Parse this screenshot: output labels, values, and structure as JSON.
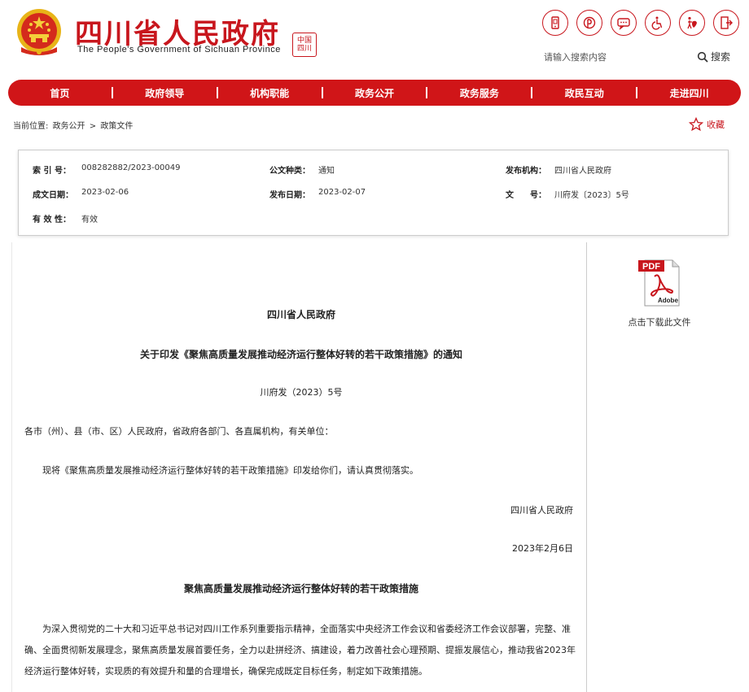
{
  "header": {
    "title": "四川省人民政府",
    "subtitle": "The People's Government of Sichuan Province",
    "seal_text": "中国四川",
    "search": {
      "placeholder": "请输入搜索内容",
      "button_label": "搜索"
    }
  },
  "nav": {
    "items": [
      "首页",
      "政府领导",
      "机构职能",
      "政务公开",
      "政务服务",
      "政民互动",
      "走进四川"
    ]
  },
  "breadcrumb": {
    "prefix": "当前位置:",
    "items": [
      "政务公开",
      ">",
      "政策文件"
    ]
  },
  "favorite": {
    "label": "收藏"
  },
  "info": {
    "index_label": "索 引 号：",
    "index_value": "008282882/2023-00049",
    "category_label": "公文种类：",
    "category_value": "通知",
    "publisher_label": "发布机构：",
    "publisher_value": "四川省人民政府",
    "created_label": "成文日期：",
    "created_value": "2023-02-06",
    "published_label": "发布日期：",
    "published_value": "2023-02-07",
    "docno_label": "文　　号：",
    "docno_value": "川府发〔2023〕5号",
    "validity_label": "有 效 性：",
    "validity_value": "有效"
  },
  "pdf": {
    "badge": "PDF",
    "brand": "Adobe",
    "label": "点击下载此文件"
  },
  "document": {
    "org": "四川省人民政府",
    "title": "关于印发《聚焦高质量发展推动经济运行整体好转的若干政策措施》的通知",
    "number": "川府发（2023）5号",
    "recipients": "各市（州）、县（市、区）人民政府，省政府各部门、各直属机构，有关单位：",
    "body": "现将《聚焦高质量发展推动经济运行整体好转的若干政策措施》印发给你们，请认真贯彻落实。",
    "signature": "四川省人民政府",
    "date": "2023年2月6日",
    "subtitle": "聚焦高质量发展推动经济运行整体好转的若干政策措施",
    "paragraph": "为深入贯彻党的二十大和习近平总书记对四川工作系列重要指示精神，全面落实中央经济工作会议和省委经济工作会议部署，完整、准确、全面贯彻新发展理念，聚焦高质量发展首要任务，全力以赴拼经济、搞建设，着力改善社会心理预期、提振发展信心，推动我省2023年经济运行整体好转，实现质的有效提升和量的合理增长，确保完成既定目标任务，制定如下政策措施。"
  },
  "colors": {
    "brand_red": "#c8161d",
    "nav_red": "#d01518"
  }
}
